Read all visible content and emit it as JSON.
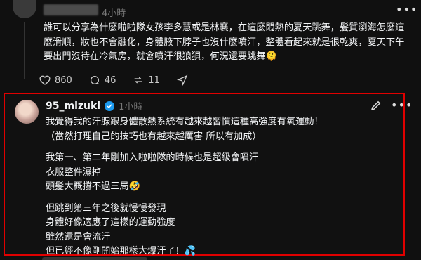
{
  "top_post": {
    "time": "4小時",
    "text": "誰可以分享為什麼啦啦隊女孩李多慧或是林襄，在這麼悶熱的夏天跳舞，髮質瀏海怎麼這麼滑順，妝也不會融化，身體腋下脖子也沒什麼噴汗，整體看起來就是很乾爽，夏天下午要出門沒待在冷氣房，就會噴汗很狼狽，何況還要跳舞🫠",
    "likes": "860",
    "comments": "46",
    "reposts": "11"
  },
  "reply": {
    "username": "95_mizuki",
    "time": "1小時",
    "lines": [
      "我覺得我的汗腺跟身體散熱系統有越來越習慣這種高強度有氧運動！",
      "（當然打理自己的技巧也有越來越厲害 所以有加成）",
      "",
      "我第一、第二年剛加入啦啦隊的時候也是超級會噴汗",
      "衣服整件濕掉",
      "頭髮大概撐不過三局🤣",
      "",
      "但跳到第三年之後就慢慢發現",
      "身體好像適應了這樣的運動強度",
      "雖然還是會流汗",
      "但已經不像剛開始那樣大爆汗了！💦"
    ]
  },
  "colors": {
    "background": "#101010",
    "highlight_border": "#e00000",
    "verified": "#1d9bf0",
    "muted_text": "#777777"
  },
  "icons": [
    "heart-icon",
    "comment-icon",
    "repost-icon",
    "edit-icon",
    "more-icon",
    "verified-badge-icon"
  ]
}
